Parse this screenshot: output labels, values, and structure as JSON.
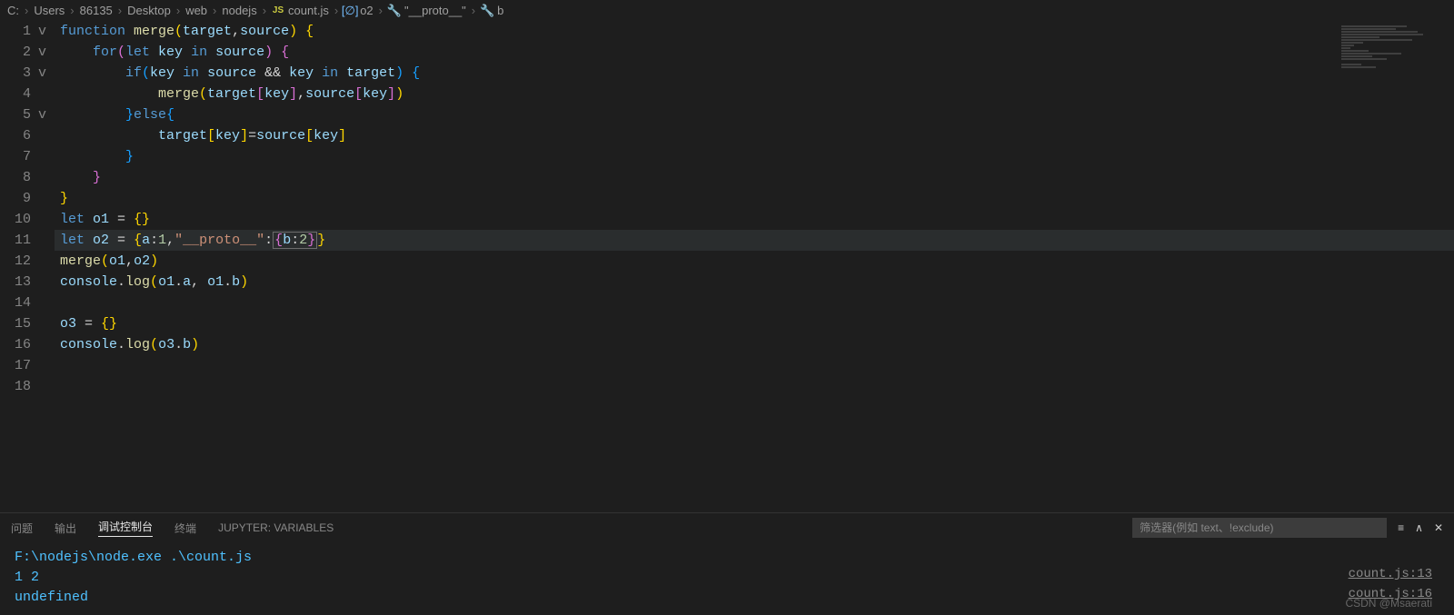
{
  "breadcrumb": {
    "parts": [
      "C:",
      "Users",
      "86135",
      "Desktop",
      "web",
      "nodejs"
    ],
    "file_icon": "JS",
    "file": "count.js",
    "sym1_icon": "object",
    "sym1": "o2",
    "sym2_icon": "wrench",
    "sym2": "\"__proto__\"",
    "sym3_icon": "wrench",
    "sym3": "b"
  },
  "editor": {
    "gutter_numbers": [
      "1",
      "2",
      "3",
      "4",
      "5",
      "6",
      "7",
      "8",
      "9",
      "10",
      "11",
      "12",
      "13",
      "14",
      "15",
      "16",
      "17",
      "18"
    ],
    "fold_marks": [
      "v",
      "v",
      "v",
      "",
      "v",
      "",
      "",
      "",
      "",
      "",
      "",
      "",
      "",
      "",
      "",
      "",
      "",
      ""
    ],
    "active_line_index": 10,
    "code": {
      "l1": {
        "a": "function ",
        "b": "merge",
        "c": "(",
        "d": "target",
        "e": ",",
        "f": "source",
        "g": ") ",
        "h": "{"
      },
      "l2": {
        "a": "    for",
        "b": "(",
        "c": "let ",
        "d": "key ",
        "e": "in ",
        "f": "source",
        "g": ") ",
        "h": "{"
      },
      "l3": {
        "a": "        if",
        "b": "(",
        "c": "key ",
        "d": "in ",
        "e": "source ",
        "f": "&& ",
        "g": "key ",
        "h": "in ",
        "i": "target",
        "j": ") ",
        "k": "{"
      },
      "l4": {
        "a": "            merge",
        "b": "(",
        "c": "target",
        "d": "[",
        "e": "key",
        "f": "]",
        "g": ",",
        "h": "source",
        "i": "[",
        "j": "key",
        "k": "]",
        "l": ")"
      },
      "l5": {
        "a": "        }",
        "b": "else",
        "c": "{"
      },
      "l6": {
        "a": "            target",
        "b": "[",
        "c": "key",
        "d": "]",
        "e": "=",
        "f": "source",
        "g": "[",
        "h": "key",
        "i": "]"
      },
      "l7": {
        "a": "        }"
      },
      "l8": {
        "a": "    }"
      },
      "l9": {
        "a": "}"
      },
      "l10": {
        "a": "let ",
        "b": "o1 ",
        "c": "= ",
        "d": "{}"
      },
      "l11": {
        "a": "let ",
        "b": "o2 ",
        "c": "= ",
        "d": "{",
        "e": "a",
        "f": ":",
        "g": "1",
        "h": ",",
        "i": "\"__proto__\"",
        "j": ":",
        "k": "{",
        "l": "b",
        "m": ":",
        "n": "2",
        "o": "}",
        "p": "}"
      },
      "l12": {
        "a": "merge",
        "b": "(",
        "c": "o1",
        "d": ",",
        "e": "o2",
        "f": ")"
      },
      "l13": {
        "a": "console",
        "b": ".",
        "c": "log",
        "d": "(",
        "e": "o1",
        "f": ".",
        "g": "a",
        "h": ", ",
        "i": "o1",
        "j": ".",
        "k": "b",
        "l": ")"
      },
      "l14": {
        "a": ""
      },
      "l15": {
        "a": "o3 ",
        "b": "= ",
        "c": "{}"
      },
      "l16": {
        "a": "console",
        "b": ".",
        "c": "log",
        "d": "(",
        "e": "o3",
        "f": ".",
        "g": "b",
        "h": ")"
      },
      "l17": {
        "a": ""
      },
      "l18": {
        "a": ""
      }
    }
  },
  "panel": {
    "tabs": {
      "problems": "问题",
      "output": "输出",
      "debug_console": "调试控制台",
      "terminal": "终端",
      "jupyter": "JUPYTER: VARIABLES"
    },
    "active_tab": "debug_console",
    "filter_placeholder": "筛选器(例如 text、!exclude)",
    "output": {
      "cmd": "F:\\nodejs\\node.exe .\\count.js",
      "line2": "1 2",
      "line3": "undefined",
      "loc1": "count.js:13",
      "loc2": "count.js:16"
    }
  },
  "watermark": "CSDN @Msaerati"
}
